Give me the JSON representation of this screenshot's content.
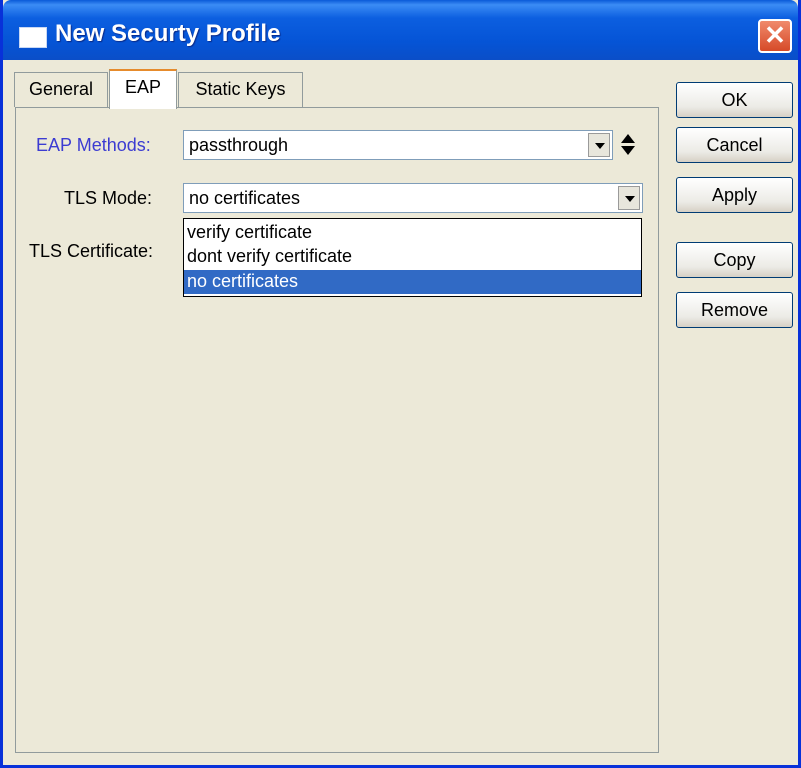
{
  "window": {
    "title": "New Securty Profile",
    "close_label": "✕"
  },
  "tabs": [
    {
      "label": "General"
    },
    {
      "label": "EAP"
    },
    {
      "label": "Static Keys"
    }
  ],
  "form": {
    "eap_methods": {
      "label": "EAP Methods:",
      "value": "passthrough"
    },
    "tls_mode": {
      "label": "TLS Mode:",
      "value": "no certificates",
      "options": [
        "verify certificate",
        "dont verify certificate",
        "no certificates"
      ],
      "selected_option": "no certificates"
    },
    "tls_certificate": {
      "label": "TLS Certificate:"
    }
  },
  "buttons": {
    "ok": "OK",
    "cancel": "Cancel",
    "apply": "Apply",
    "copy": "Copy",
    "remove": "Remove"
  },
  "colors": {
    "eap_label": "#3c3cd2",
    "selection": "#316ac5",
    "title_bar": "#0554d6"
  }
}
